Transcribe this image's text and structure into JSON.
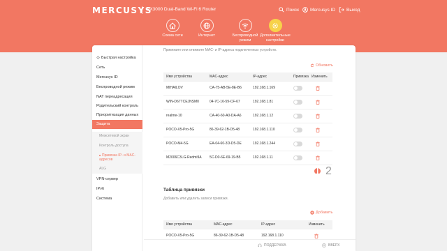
{
  "header": {
    "logo": "MERCUSYS",
    "model": "AX3000 Dual-Band Wi-Fi 6 Router",
    "links": {
      "search": "Поиск",
      "account": "Mercusys ID",
      "logout": "Выход"
    },
    "nav": [
      {
        "label": "Схема сети",
        "icon": "network-map-icon"
      },
      {
        "label": "Интернет",
        "icon": "globe-icon"
      },
      {
        "label": "Беспроводной режим",
        "icon": "wifi-icon"
      },
      {
        "label": "Дополнительные настройки",
        "icon": "gear-icon"
      }
    ]
  },
  "sidebar": {
    "items": [
      "Быстрая настройка",
      "Сеть",
      "Mercusys ID",
      "Беспроводной режим",
      "NAT переадресация",
      "Родительский контроль",
      "Приоритизация данных",
      "Защита",
      "VPN-сервер",
      "IPv6",
      "Система"
    ],
    "sub_items": [
      "Межсетевой экран",
      "Контроль доступа",
      "Привязка IP- и MAC-адресов",
      "ALG"
    ]
  },
  "content": {
    "description": "Привяжите или отвяжите MAC- и IP-адреса подключенных устройств.",
    "refresh": "Обновить",
    "table": {
      "columns": [
        "Имя устройства",
        "MAC-адрес",
        "IP-адрес",
        "Привязка",
        "Изменить"
      ],
      "rows": [
        [
          "MIHAILOV",
          "CA-75-AB-5E-8E-B6",
          "192.168.1.169"
        ],
        [
          "WIN-D67TCEJNSM0",
          "04-7C-16-59-CF-67",
          "192.168.1.81"
        ],
        [
          "realme-10",
          "CA-40-60-A0-DA-A6",
          "192.168.1.12"
        ],
        [
          "POCO-X5-Pro-5G",
          "86-39-62-1B-D5-48",
          "192.168.1.110"
        ],
        [
          "POCO-M4-5G",
          "EA-04-60-3D-D5-DE",
          "192.168.1.244"
        ],
        [
          "M2006C3LG-Redmi9A",
          "5C-D0-6E-69-19-B5",
          "192.168.1.11"
        ]
      ]
    },
    "pagination": [
      "1",
      "2"
    ],
    "binding": {
      "title": "Таблица привязки",
      "description": "Добавить или удалить записи привязки.",
      "add": "Добавить",
      "columns": [
        "Имя устройства",
        "MAC-адрес",
        "IP-адрес",
        "Изменить"
      ],
      "rows": [
        [
          "POCO-X5-Pro-5G",
          "86-39-62-1B-D5-48",
          "192.168.1.110"
        ]
      ]
    }
  },
  "footer": {
    "support": "ПОДДЕРЖКА",
    "top": "ВВЕРХ"
  },
  "colors": {
    "accent": "#f27762",
    "active_nav": "#f7d24a"
  }
}
